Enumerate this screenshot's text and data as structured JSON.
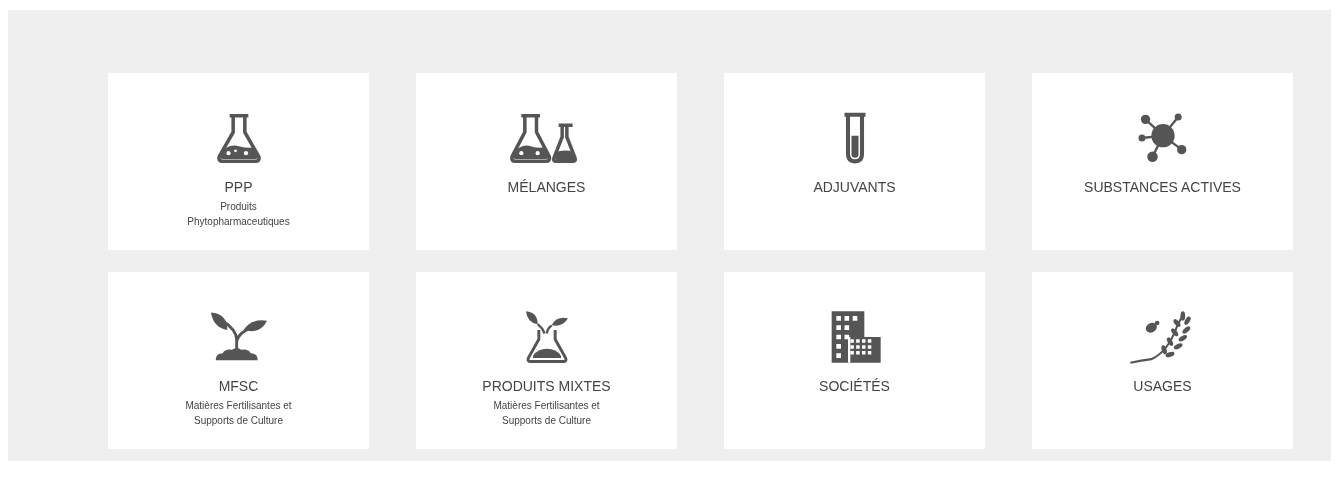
{
  "tiles": [
    {
      "kind": "flask",
      "title": "PPP",
      "subtitle_lines": [
        "Produits",
        "Phytopharmaceutiques"
      ]
    },
    {
      "kind": "flasks",
      "title": "MÉLANGES"
    },
    {
      "kind": "tube",
      "title": "ADJUVANTS"
    },
    {
      "kind": "molecule",
      "title": "SUBSTANCES ACTIVES"
    },
    {
      "kind": "sprout",
      "title": "MFSC",
      "subtitle_lines": [
        "Matières Fertilisantes et",
        "Supports de Culture"
      ]
    },
    {
      "kind": "sprout-flask",
      "title": "PRODUITS MIXTES",
      "subtitle_lines": [
        "Matières Fertilisantes et",
        "Supports de Culture"
      ]
    },
    {
      "kind": "buildings",
      "title": "SOCIÉTÉS"
    },
    {
      "kind": "wheat",
      "title": "USAGES"
    }
  ]
}
